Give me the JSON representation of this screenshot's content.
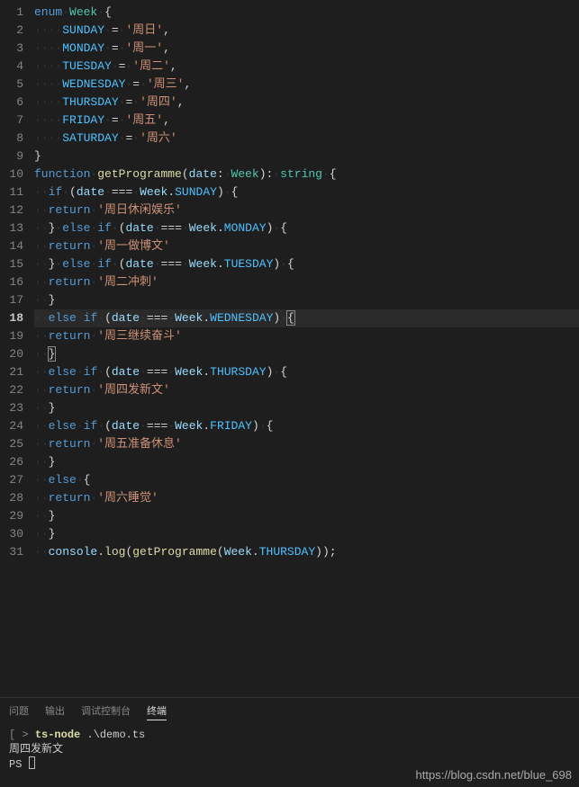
{
  "code": {
    "lines": [
      {
        "n": 1,
        "tokens": [
          [
            "kw",
            "enum"
          ],
          [
            "ws",
            "·"
          ],
          [
            "type",
            "Week"
          ],
          [
            "ws",
            "·"
          ],
          [
            "paren",
            "{"
          ]
        ]
      },
      {
        "n": 2,
        "tokens": [
          [
            "ws",
            "····"
          ],
          [
            "enumm",
            "SUNDAY"
          ],
          [
            "ws",
            "·"
          ],
          [
            "op",
            "="
          ],
          [
            "ws",
            "·"
          ],
          [
            "str",
            "'周日'"
          ],
          [
            "punc",
            ","
          ]
        ]
      },
      {
        "n": 3,
        "tokens": [
          [
            "ws",
            "····"
          ],
          [
            "enumm",
            "MONDAY"
          ],
          [
            "ws",
            "·"
          ],
          [
            "op",
            "="
          ],
          [
            "ws",
            "·"
          ],
          [
            "str",
            "'周一'"
          ],
          [
            "punc",
            ","
          ]
        ]
      },
      {
        "n": 4,
        "tokens": [
          [
            "ws",
            "····"
          ],
          [
            "enumm",
            "TUESDAY"
          ],
          [
            "ws",
            "·"
          ],
          [
            "op",
            "="
          ],
          [
            "ws",
            "·"
          ],
          [
            "str",
            "'周二'"
          ],
          [
            "punc",
            ","
          ]
        ]
      },
      {
        "n": 5,
        "tokens": [
          [
            "ws",
            "····"
          ],
          [
            "enumm",
            "WEDNESDAY"
          ],
          [
            "ws",
            "·"
          ],
          [
            "op",
            "="
          ],
          [
            "ws",
            "·"
          ],
          [
            "str",
            "'周三'"
          ],
          [
            "punc",
            ","
          ]
        ]
      },
      {
        "n": 6,
        "tokens": [
          [
            "ws",
            "····"
          ],
          [
            "enumm",
            "THURSDAY"
          ],
          [
            "ws",
            "·"
          ],
          [
            "op",
            "="
          ],
          [
            "ws",
            "·"
          ],
          [
            "str",
            "'周四'"
          ],
          [
            "punc",
            ","
          ]
        ]
      },
      {
        "n": 7,
        "tokens": [
          [
            "ws",
            "····"
          ],
          [
            "enumm",
            "FRIDAY"
          ],
          [
            "ws",
            "·"
          ],
          [
            "op",
            "="
          ],
          [
            "ws",
            "·"
          ],
          [
            "str",
            "'周五'"
          ],
          [
            "punc",
            ","
          ]
        ]
      },
      {
        "n": 8,
        "tokens": [
          [
            "ws",
            "····"
          ],
          [
            "enumm",
            "SATURDAY"
          ],
          [
            "ws",
            "·"
          ],
          [
            "op",
            "="
          ],
          [
            "ws",
            "·"
          ],
          [
            "str",
            "'周六'"
          ]
        ]
      },
      {
        "n": 9,
        "tokens": [
          [
            "paren",
            "}"
          ]
        ]
      },
      {
        "n": 10,
        "tokens": [
          [
            "kw",
            "function"
          ],
          [
            "ws",
            "·"
          ],
          [
            "fn",
            "getProgramme"
          ],
          [
            "paren",
            "("
          ],
          [
            "var",
            "date"
          ],
          [
            "punc",
            ":"
          ],
          [
            "ws",
            "·"
          ],
          [
            "type",
            "Week"
          ],
          [
            "paren",
            ")"
          ],
          [
            "punc",
            ":"
          ],
          [
            "ws",
            "·"
          ],
          [
            "type",
            "string"
          ],
          [
            "ws",
            "·"
          ],
          [
            "paren",
            "{"
          ]
        ]
      },
      {
        "n": 11,
        "tokens": [
          [
            "ws",
            "··"
          ],
          [
            "kw",
            "if"
          ],
          [
            "ws",
            "·"
          ],
          [
            "paren",
            "("
          ],
          [
            "var",
            "date"
          ],
          [
            "ws",
            "·"
          ],
          [
            "op",
            "==="
          ],
          [
            "ws",
            "·"
          ],
          [
            "var",
            "Week"
          ],
          [
            "punc",
            "."
          ],
          [
            "enumm",
            "SUNDAY"
          ],
          [
            "paren",
            ")"
          ],
          [
            "ws",
            "·"
          ],
          [
            "paren",
            "{"
          ]
        ]
      },
      {
        "n": 12,
        "tokens": [
          [
            "ws",
            "··"
          ],
          [
            "kw",
            "return"
          ],
          [
            "ws",
            "·"
          ],
          [
            "str",
            "'周日休闲娱乐'"
          ]
        ]
      },
      {
        "n": 13,
        "tokens": [
          [
            "ws",
            "··"
          ],
          [
            "paren",
            "}"
          ],
          [
            "ws",
            "·"
          ],
          [
            "kw",
            "else"
          ],
          [
            "ws",
            "·"
          ],
          [
            "kw",
            "if"
          ],
          [
            "ws",
            "·"
          ],
          [
            "paren",
            "("
          ],
          [
            "var",
            "date"
          ],
          [
            "ws",
            "·"
          ],
          [
            "op",
            "==="
          ],
          [
            "ws",
            "·"
          ],
          [
            "var",
            "Week"
          ],
          [
            "punc",
            "."
          ],
          [
            "enumm",
            "MONDAY"
          ],
          [
            "paren",
            ")"
          ],
          [
            "ws",
            "·"
          ],
          [
            "paren",
            "{"
          ]
        ]
      },
      {
        "n": 14,
        "tokens": [
          [
            "ws",
            "··"
          ],
          [
            "kw",
            "return"
          ],
          [
            "ws",
            "·"
          ],
          [
            "str",
            "'周一做博文'"
          ]
        ]
      },
      {
        "n": 15,
        "tokens": [
          [
            "ws",
            "··"
          ],
          [
            "paren",
            "}"
          ],
          [
            "ws",
            "·"
          ],
          [
            "kw",
            "else"
          ],
          [
            "ws",
            "·"
          ],
          [
            "kw",
            "if"
          ],
          [
            "ws",
            "·"
          ],
          [
            "paren",
            "("
          ],
          [
            "var",
            "date"
          ],
          [
            "ws",
            "·"
          ],
          [
            "op",
            "==="
          ],
          [
            "ws",
            "·"
          ],
          [
            "var",
            "Week"
          ],
          [
            "punc",
            "."
          ],
          [
            "enumm",
            "TUESDAY"
          ],
          [
            "paren",
            ")"
          ],
          [
            "ws",
            "·"
          ],
          [
            "paren",
            "{"
          ]
        ]
      },
      {
        "n": 16,
        "tokens": [
          [
            "ws",
            "··"
          ],
          [
            "kw",
            "return"
          ],
          [
            "ws",
            "·"
          ],
          [
            "str",
            "'周二冲刺'"
          ]
        ]
      },
      {
        "n": 17,
        "tokens": [
          [
            "ws",
            "··"
          ],
          [
            "paren",
            "}"
          ]
        ]
      },
      {
        "n": 18,
        "active": true,
        "tokens": [
          [
            "ws",
            "··"
          ],
          [
            "kw",
            "else"
          ],
          [
            "ws",
            "·"
          ],
          [
            "kw",
            "if"
          ],
          [
            "ws",
            "·"
          ],
          [
            "paren",
            "("
          ],
          [
            "var",
            "date"
          ],
          [
            "ws",
            "·"
          ],
          [
            "op",
            "==="
          ],
          [
            "ws",
            "·"
          ],
          [
            "var",
            "Week"
          ],
          [
            "punc",
            "."
          ],
          [
            "enumm",
            "WEDNESDAY"
          ],
          [
            "paren",
            ")"
          ],
          [
            "ws",
            "·"
          ],
          [
            "match",
            "{"
          ]
        ]
      },
      {
        "n": 19,
        "tokens": [
          [
            "ws",
            "··"
          ],
          [
            "kw",
            "return"
          ],
          [
            "ws",
            "·"
          ],
          [
            "str",
            "'周三继续奋斗'"
          ]
        ]
      },
      {
        "n": 20,
        "tokens": [
          [
            "ws",
            "··"
          ],
          [
            "match",
            "}"
          ]
        ]
      },
      {
        "n": 21,
        "tokens": [
          [
            "ws",
            "··"
          ],
          [
            "kw",
            "else"
          ],
          [
            "ws",
            "·"
          ],
          [
            "kw",
            "if"
          ],
          [
            "ws",
            "·"
          ],
          [
            "paren",
            "("
          ],
          [
            "var",
            "date"
          ],
          [
            "ws",
            "·"
          ],
          [
            "op",
            "==="
          ],
          [
            "ws",
            "·"
          ],
          [
            "var",
            "Week"
          ],
          [
            "punc",
            "."
          ],
          [
            "enumm",
            "THURSDAY"
          ],
          [
            "paren",
            ")"
          ],
          [
            "ws",
            "·"
          ],
          [
            "paren",
            "{"
          ]
        ]
      },
      {
        "n": 22,
        "tokens": [
          [
            "ws",
            "··"
          ],
          [
            "kw",
            "return"
          ],
          [
            "ws",
            "·"
          ],
          [
            "str",
            "'周四发新文'"
          ]
        ]
      },
      {
        "n": 23,
        "tokens": [
          [
            "ws",
            "··"
          ],
          [
            "paren",
            "}"
          ]
        ]
      },
      {
        "n": 24,
        "tokens": [
          [
            "ws",
            "··"
          ],
          [
            "kw",
            "else"
          ],
          [
            "ws",
            "·"
          ],
          [
            "kw",
            "if"
          ],
          [
            "ws",
            "·"
          ],
          [
            "paren",
            "("
          ],
          [
            "var",
            "date"
          ],
          [
            "ws",
            "·"
          ],
          [
            "op",
            "==="
          ],
          [
            "ws",
            "·"
          ],
          [
            "var",
            "Week"
          ],
          [
            "punc",
            "."
          ],
          [
            "enumm",
            "FRIDAY"
          ],
          [
            "paren",
            ")"
          ],
          [
            "ws",
            "·"
          ],
          [
            "paren",
            "{"
          ]
        ]
      },
      {
        "n": 25,
        "tokens": [
          [
            "ws",
            "··"
          ],
          [
            "kw",
            "return"
          ],
          [
            "ws",
            "·"
          ],
          [
            "str",
            "'周五准备休息'"
          ]
        ]
      },
      {
        "n": 26,
        "tokens": [
          [
            "ws",
            "··"
          ],
          [
            "paren",
            "}"
          ]
        ]
      },
      {
        "n": 27,
        "tokens": [
          [
            "ws",
            "··"
          ],
          [
            "kw",
            "else"
          ],
          [
            "ws",
            "·"
          ],
          [
            "paren",
            "{"
          ]
        ]
      },
      {
        "n": 28,
        "tokens": [
          [
            "ws",
            "··"
          ],
          [
            "kw",
            "return"
          ],
          [
            "ws",
            "·"
          ],
          [
            "str",
            "'周六睡觉'"
          ]
        ]
      },
      {
        "n": 29,
        "tokens": [
          [
            "ws",
            "··"
          ],
          [
            "paren",
            "}"
          ]
        ]
      },
      {
        "n": 30,
        "tokens": [
          [
            "ws",
            "··"
          ],
          [
            "paren",
            "}"
          ]
        ]
      },
      {
        "n": 31,
        "tokens": [
          [
            "ws",
            "··"
          ],
          [
            "var",
            "console"
          ],
          [
            "punc",
            "."
          ],
          [
            "fn",
            "log"
          ],
          [
            "paren",
            "("
          ],
          [
            "fn",
            "getProgramme"
          ],
          [
            "paren",
            "("
          ],
          [
            "var",
            "Week"
          ],
          [
            "punc",
            "."
          ],
          [
            "enumm",
            "THURSDAY"
          ],
          [
            "paren",
            ")"
          ],
          [
            "paren",
            ")"
          ],
          [
            "punc",
            ";"
          ]
        ]
      }
    ]
  },
  "panel": {
    "tabs": {
      "problems": "问题",
      "output": "输出",
      "debug": "调试控制台",
      "terminal": "终端"
    },
    "active_tab": "terminal",
    "terminal": {
      "line1_prefix": "[",
      "line1_path": "                         ",
      "line1_suffix": "> ",
      "line1_cmd": "ts-node",
      "line1_arg": " .\\demo.ts",
      "output": "周四发新文",
      "prompt": "PS "
    }
  },
  "watermark": "https://blog.csdn.net/blue_698"
}
